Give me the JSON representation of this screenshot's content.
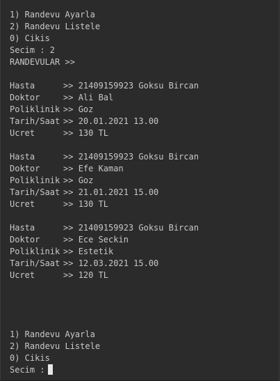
{
  "menu_top": {
    "item1": "1) Randevu Ayarla",
    "item2": "2) Randevu Listele",
    "item0": "0) Cikis",
    "selection": "Secim : 2"
  },
  "list_header": "RANDEVULAR >>",
  "field_labels": {
    "patient": "Hasta",
    "doctor": "Doktor",
    "clinic": "Poliklinik",
    "datetime": "Tarih/Saat",
    "fee": "Ucret"
  },
  "separator": ">> ",
  "appointments": [
    {
      "patient": "21409159923 Goksu Bircan",
      "doctor": "Ali Bal",
      "clinic": "Goz",
      "datetime": "20.01.2021 13.00",
      "fee": "130 TL"
    },
    {
      "patient": "21409159923 Goksu Bircan",
      "doctor": "Efe Kaman",
      "clinic": "Goz",
      "datetime": "21.01.2021 15.00",
      "fee": "130 TL"
    },
    {
      "patient": "21409159923 Goksu Bircan",
      "doctor": "Ece Seckin",
      "clinic": "Estetik",
      "datetime": "12.03.2021 15.00",
      "fee": "120 TL"
    }
  ],
  "menu_bottom": {
    "item1": "1) Randevu Ayarla",
    "item2": "2) Randevu Listele",
    "item0": "0) Cikis",
    "prompt": "Secim :"
  },
  "colors": {
    "background": "#2b2b2b",
    "text": "#c8c8c8",
    "cursor": "#e6e6e6"
  },
  "icons": {
    "cursor": "block-cursor-icon"
  }
}
